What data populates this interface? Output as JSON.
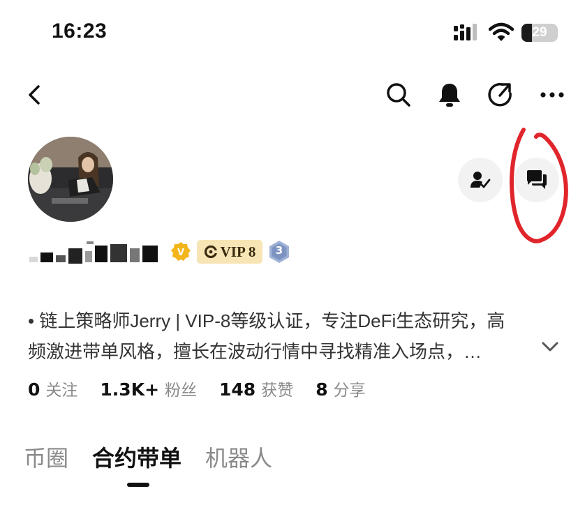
{
  "status_bar": {
    "time": "16:23",
    "battery_percent": "29",
    "battery_level": 0.29,
    "icons": [
      "signal-icon",
      "wifi-icon",
      "battery-icon"
    ]
  },
  "nav": {
    "icons": [
      "back-icon",
      "search-icon",
      "bell-icon",
      "share-icon",
      "more-icon"
    ]
  },
  "profile": {
    "follow_icon": "user-check-icon",
    "message_icon": "chat-icon",
    "badges": {
      "verified_letter": "V",
      "vip_label": "VIP 8",
      "level": "3"
    },
    "bio_lines": [
      "• 链上策略师Jerry | VIP-8等级认证，专注DeFi生态研究，高",
      "频激进带单风格，擅长在波动行情中寻找精准入场点，…"
    ]
  },
  "stats": [
    {
      "value": "0",
      "label": "关注"
    },
    {
      "value": "1.3K+",
      "label": "粉丝"
    },
    {
      "value": "148",
      "label": "获赞"
    },
    {
      "value": "8",
      "label": "分享"
    }
  ],
  "tabs": [
    {
      "label": "币圈",
      "active": false
    },
    {
      "label": "合约带单",
      "active": true
    },
    {
      "label": "机器人",
      "active": false
    }
  ],
  "colors": {
    "annotation_red": "#e0252b",
    "vip_badge_bg": "#f7e5b5",
    "verified_gold": "#f2b51a",
    "level_blue": "#9fb2d6"
  }
}
